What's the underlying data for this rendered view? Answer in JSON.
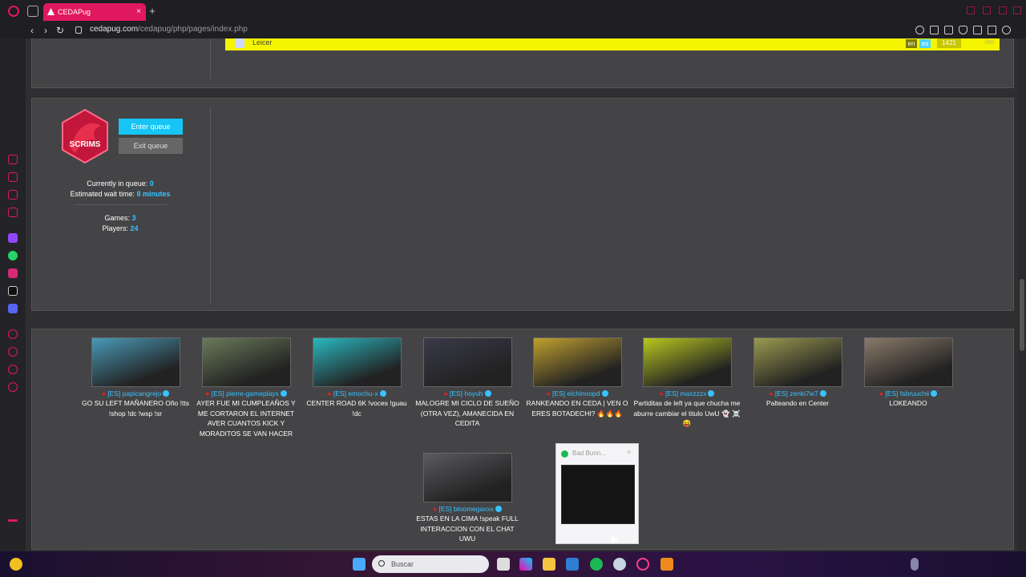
{
  "browser": {
    "tab_title": "CEDAPug",
    "tab_close": "×",
    "new_tab": "+",
    "url_host": "cedapug.com",
    "url_path": "/cedapug/php/pages/index.php"
  },
  "top_panel": {
    "player_name": "Leicer",
    "lang1": "en",
    "lang2": "es",
    "elo": "1421",
    "time": "0m"
  },
  "queue": {
    "logo_text": "SCRIMS",
    "enter_label": "Enter queue",
    "exit_label": "Exit queue",
    "in_queue_label": "Currently in queue:",
    "in_queue_value": "0",
    "wait_label": "Estimated wait time:",
    "wait_value": "8 minutes",
    "games_label": "Games:",
    "games_value": "3",
    "players_label": "Players:",
    "players_value": "24"
  },
  "streams": [
    {
      "channel": "[ES] papicangrejo",
      "title": "GO SU LEFT MAÑANERO Oño !tts !shop !dc !wsp !sr",
      "color": "#4a9ab8"
    },
    {
      "channel": "[ES] pierre-gameplays",
      "title": "AYER FUE MI CUMPLEAÑOS Y ME CORTARON EL INTERNET AVER CUANTOS KICK Y MORADITOS SE VAN HACER",
      "color": "#6a7a5a"
    },
    {
      "channel": "[ES] emochu-x",
      "title": "CENTER ROAD 6K !voces !guau !dc",
      "color": "#2ab8c0"
    },
    {
      "channel": "[ES] hoyuh",
      "title": "MALOGRE MI CICLO DE SUEÑO (OTRA VEZ), AMANECIDA EN CEDITA",
      "color": "#3a3a4a"
    },
    {
      "channel": "[ES] elchinoopd",
      "title": "RANKEANDO EN CEDA | VEN O ERES BOTADECHI? 🔥🔥🔥",
      "color": "#c0a030"
    },
    {
      "channel": "[ES] maxzzzx",
      "title": "Partiditas de left ya que chucha me aburre cambiar el titulo UwU 👻 ☠️😝",
      "color": "#b8c820"
    },
    {
      "channel": "[ES] zenki7w7",
      "title": "Palteando en Center",
      "color": "#9a9a50"
    },
    {
      "channel": "[ES] fsbruuchii",
      "title": "LOKEANDO",
      "color": "#8a7a6a"
    },
    {
      "channel": "[ES] bloomegaxxx",
      "title": "ESTAS EN LA CIMA !speak FULL INTERACCION CON EL CHAT UWU",
      "color": "#5a5a60"
    }
  ],
  "spotify": {
    "title": "Bad Bunn..."
  },
  "taskbar": {
    "search_placeholder": "Buscar"
  }
}
